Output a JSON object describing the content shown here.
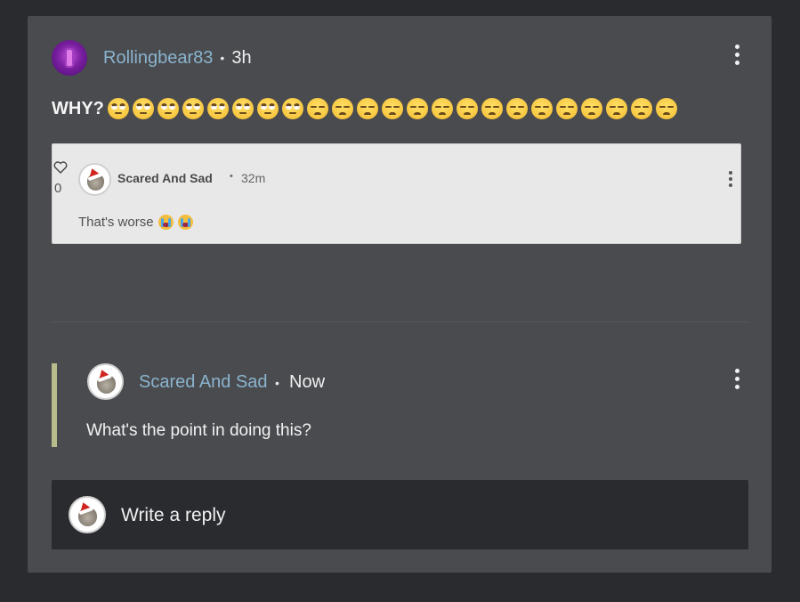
{
  "post": {
    "author": "Rollingbear83",
    "separator": "•",
    "time": "3h",
    "text_prefix": "WHY?",
    "emojis": {
      "rolling_eyes_count": 8,
      "unamused_count": 15
    }
  },
  "quoted_comment": {
    "like_count": "0",
    "author": "Scared And Sad",
    "separator": "•",
    "time": "32m",
    "text": "That's worse"
  },
  "reply": {
    "author": "Scared And Sad",
    "separator": "•",
    "time": "Now",
    "text": "What's the point in doing this?"
  },
  "reply_box": {
    "placeholder": "Write a reply"
  },
  "colors": {
    "background": "#2a2b2f",
    "card": "#4a4b4f",
    "link": "#8ab4ce",
    "reply_bar": "#b8bb8a",
    "quoted_bg": "#e8e8e8"
  }
}
